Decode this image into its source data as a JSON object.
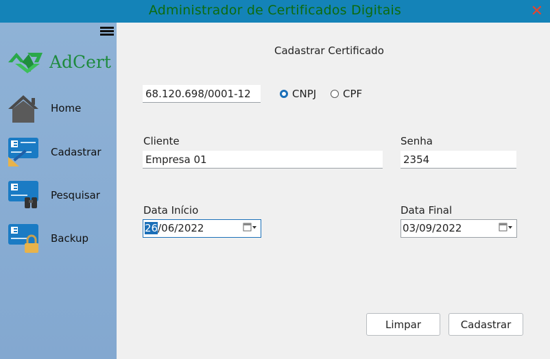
{
  "window": {
    "title": "Administrador de Certificados Digitais",
    "close_glyph": "✕"
  },
  "sidebar": {
    "logo_text": "AdCert",
    "items": [
      {
        "label": "Home",
        "icon": "home-icon"
      },
      {
        "label": "Cadastrar",
        "icon": "register-card-icon"
      },
      {
        "label": "Pesquisar",
        "icon": "search-card-icon"
      },
      {
        "label": "Backup",
        "icon": "backup-card-lock-icon"
      }
    ]
  },
  "form": {
    "heading": "Cadastrar Certificado",
    "document_value": "68.120.698/0001-12",
    "doc_type_options": [
      {
        "label": "CNPJ",
        "checked": true
      },
      {
        "label": "CPF",
        "checked": false
      }
    ],
    "cliente_label": "Cliente",
    "cliente_value": "Empresa 01",
    "senha_label": "Senha",
    "senha_value": "2354",
    "data_inicio_label": "Data Início",
    "data_inicio_selected": "26",
    "data_inicio_rest": "/06/2022",
    "data_final_label": "Data Final",
    "data_final_value": "03/09/2022",
    "limpar_label": "Limpar",
    "cadastrar_label": "Cadastrar"
  },
  "colors": {
    "titlebar": "#1483b8",
    "title_text": "#0d6b0d",
    "close": "#e8442c",
    "sidebar": "#8fb2d6",
    "accent": "#1a6fb8",
    "logo_green": "#1e8a3e"
  }
}
